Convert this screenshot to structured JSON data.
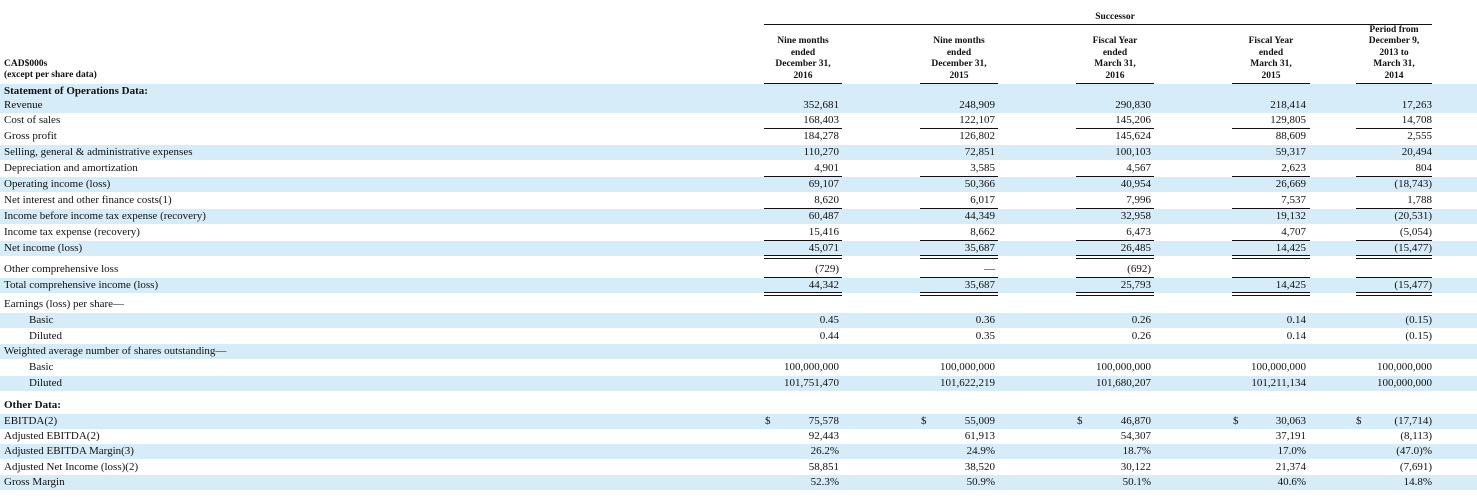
{
  "header": {
    "successor_label": "Successor",
    "units_line1": "CAD$000s",
    "units_line2": "(except per share data)",
    "columns": [
      [
        "Nine months",
        "ended",
        "December 31,",
        "2016"
      ],
      [
        "Nine months",
        "ended",
        "December 31,",
        "2015"
      ],
      [
        "Fiscal Year",
        "ended",
        "March 31,",
        "2016"
      ],
      [
        "Fiscal Year",
        "ended",
        "March 31,",
        "2015"
      ],
      [
        "Period from",
        "December 9,",
        "2013 to",
        "March 31,",
        "2014"
      ]
    ]
  },
  "rows": [
    {
      "label": "Statement of Operations Data:",
      "bold": true,
      "values": null
    },
    {
      "label": "Revenue",
      "values": [
        "352,681",
        "248,909",
        "290,830",
        "218,414",
        "17,263"
      ]
    },
    {
      "label": "Cost of sales",
      "values": [
        "168,403",
        "122,107",
        "145,206",
        "129,805",
        "14,708"
      ],
      "rule": "single"
    },
    {
      "label": "Gross profit",
      "values": [
        "184,278",
        "126,802",
        "145,624",
        "88,609",
        "2,555"
      ]
    },
    {
      "label": "Selling, general & administrative expenses",
      "values": [
        "110,270",
        "72,851",
        "100,103",
        "59,317",
        "20,494"
      ]
    },
    {
      "label": "Depreciation and amortization",
      "values": [
        "4,901",
        "3,585",
        "4,567",
        "2,623",
        "804"
      ],
      "rule": "single"
    },
    {
      "label": "Operating income (loss)",
      "values": [
        "69,107",
        "50,366",
        "40,954",
        "26,669",
        "(18,743)"
      ]
    },
    {
      "label": "Net interest and other finance costs(1)",
      "values": [
        "8,620",
        "6,017",
        "7,996",
        "7,537",
        "1,788"
      ],
      "rule": "single"
    },
    {
      "label": "Income before income tax expense (recovery)",
      "values": [
        "60,487",
        "44,349",
        "32,958",
        "19,132",
        "(20,531)"
      ]
    },
    {
      "label": "Income tax expense (recovery)",
      "values": [
        "15,416",
        "8,662",
        "6,473",
        "4,707",
        "(5,054)"
      ],
      "rule": "single"
    },
    {
      "label": "Net income (loss)",
      "values": [
        "45,071",
        "35,687",
        "26,485",
        "14,425",
        "(15,477)"
      ],
      "rule": "double"
    },
    {
      "label": "Other comprehensive loss",
      "values": [
        "(729)",
        "—",
        "(692)",
        "",
        ""
      ],
      "rule": "single"
    },
    {
      "label": "Total comprehensive income (loss)",
      "values": [
        "44,342",
        "35,687",
        "25,793",
        "14,425",
        "(15,477)"
      ],
      "rule": "double"
    },
    {
      "label": "Earnings (loss) per share—",
      "values": null
    },
    {
      "label": "Basic",
      "indent": true,
      "values": [
        "0.45",
        "0.36",
        "0.26",
        "0.14",
        "(0.15)"
      ]
    },
    {
      "label": "Diluted",
      "indent": true,
      "values": [
        "0.44",
        "0.35",
        "0.26",
        "0.14",
        "(0.15)"
      ]
    },
    {
      "label": "Weighted average number of shares outstanding—",
      "values": null
    },
    {
      "label": "Basic",
      "indent": true,
      "values": [
        "100,000,000",
        "100,000,000",
        "100,000,000",
        "100,000,000",
        "100,000,000"
      ]
    },
    {
      "label": "Diluted",
      "indent": true,
      "values": [
        "101,751,470",
        "101,622,219",
        "101,680,207",
        "101,211,134",
        "100,000,000"
      ]
    },
    {
      "label": "Other Data:",
      "bold": true,
      "values": null
    },
    {
      "label": "EBITDA(2)",
      "values": [
        "75,578",
        "55,009",
        "46,870",
        "30,063",
        "(17,714)"
      ],
      "dollar": "$"
    },
    {
      "label": "Adjusted EBITDA(2)",
      "values": [
        "92,443",
        "61,913",
        "54,307",
        "37,191",
        "(8,113)"
      ]
    },
    {
      "label": "Adjusted EBITDA Margin(3)",
      "values": [
        "26.2%",
        "24.9%",
        "18.7%",
        "17.0%",
        "(47.0)%"
      ]
    },
    {
      "label": "Adjusted Net Income (loss)(2)",
      "values": [
        "58,851",
        "38,520",
        "30,122",
        "21,374",
        "(7,691)"
      ]
    },
    {
      "label": "Gross Margin",
      "values": [
        "52.3%",
        "50.9%",
        "50.1%",
        "40.6%",
        "14.8%"
      ]
    }
  ]
}
